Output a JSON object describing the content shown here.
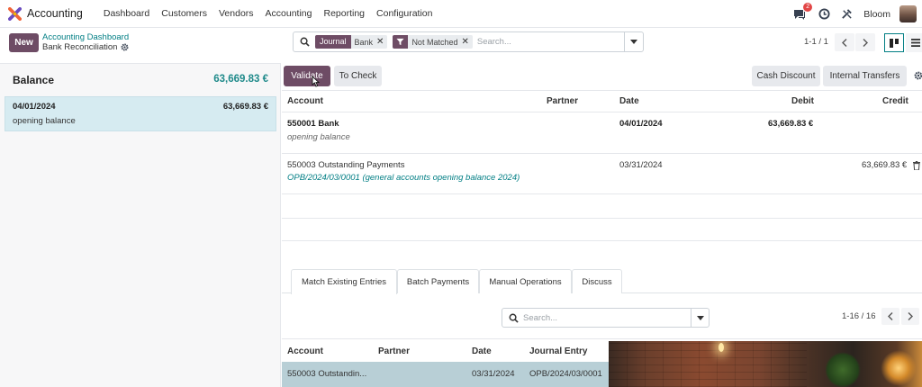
{
  "navbar": {
    "app_name": "Accounting",
    "menu": [
      "Dashboard",
      "Customers",
      "Vendors",
      "Accounting",
      "Reporting",
      "Configuration"
    ],
    "chat_badge": "2",
    "company": "Bloom"
  },
  "control": {
    "new_label": "New",
    "breadcrumb_parent": "Accounting Dashboard",
    "breadcrumb_current": "Bank Reconciliation",
    "facets": [
      {
        "tag": "Journal",
        "value": "Bank"
      },
      {
        "value": "Not Matched"
      }
    ],
    "search_placeholder": "Search...",
    "pager": "1-1 / 1"
  },
  "left": {
    "balance_label": "Balance",
    "balance_amount": "63,669.83 €",
    "line": {
      "date": "04/01/2024",
      "amount": "63,669.83 €",
      "label": "opening balance"
    }
  },
  "actions": {
    "validate": "Validate",
    "to_check": "To Check",
    "cash_discount": "Cash Discount",
    "internal_transfers": "Internal Transfers"
  },
  "entries": {
    "headers": {
      "account": "Account",
      "partner": "Partner",
      "date": "Date",
      "debit": "Debit",
      "credit": "Credit"
    },
    "rows": [
      {
        "account": "550001 Bank",
        "label": "opening balance",
        "partner": "",
        "date": "04/01/2024",
        "debit": "63,669.83 €",
        "credit": ""
      },
      {
        "account": "550003 Outstanding Payments",
        "label": "OPB/2024/03/0001 (general accounts opening balance 2024)",
        "partner": "",
        "date": "03/31/2024",
        "debit": "",
        "credit": "63,669.83 €"
      }
    ]
  },
  "tabs": [
    "Match Existing Entries",
    "Batch Payments",
    "Manual Operations",
    "Discuss"
  ],
  "match": {
    "search_placeholder": "Search...",
    "pager": "1-16 / 16",
    "headers": {
      "account": "Account",
      "partner": "Partner",
      "date": "Date",
      "journal_entry": "Journal Entry"
    },
    "row": {
      "account": "550003 Outstandin...",
      "partner": "",
      "date": "03/31/2024",
      "journal_entry": "OPB/2024/03/0001"
    }
  },
  "colors": {
    "primary": "#6e4c65",
    "accent": "#017e84",
    "balance": "#1f8a8a",
    "selected_line": "#d6ebf1"
  }
}
